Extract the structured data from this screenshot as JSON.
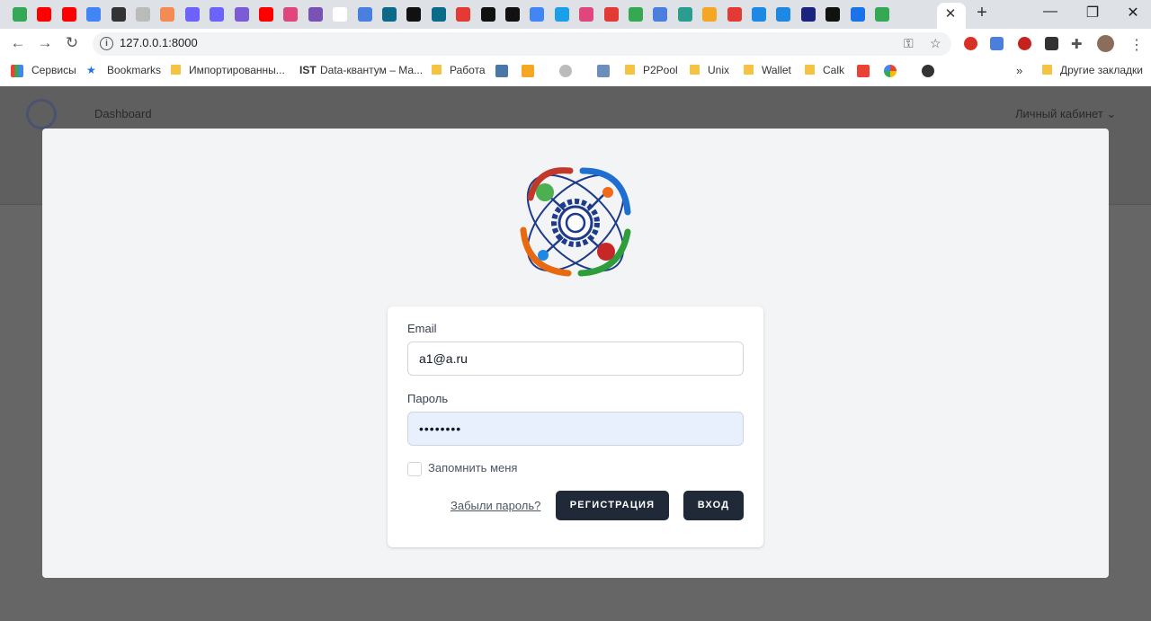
{
  "browser": {
    "url": "127.0.0.1:8000",
    "tab_close_glyph": "✕",
    "new_tab_glyph": "+",
    "window_controls": [
      "—",
      "❐",
      "✕"
    ],
    "bookmarks": [
      {
        "label": "Сервисы",
        "icon": "apps-grid-icon"
      },
      {
        "label": "Bookmarks",
        "icon": "star-icon"
      },
      {
        "label": "Импортированны...",
        "icon": "folder-icon"
      },
      {
        "label": "Data-квантум – Ма...",
        "icon": "ist-icon",
        "prefix": "IST"
      },
      {
        "label": "Работа",
        "icon": "folder-icon"
      },
      {
        "label": "P2Pool",
        "icon": "folder-icon"
      },
      {
        "label": "Unix",
        "icon": "folder-icon"
      },
      {
        "label": "Wallet",
        "icon": "folder-icon"
      },
      {
        "label": "Calk",
        "icon": "folder-icon"
      },
      {
        "label": "Другие закладки",
        "icon": "folder-icon"
      }
    ],
    "more_bookmarks_glyph": "»"
  },
  "app": {
    "nav_link": "Dashboard",
    "account_menu": "Личный кабинет ⌄"
  },
  "login": {
    "email_label": "Email",
    "email_value": "a1@a.ru",
    "password_label": "Пароль",
    "password_value": "••••••••",
    "remember_label": "Запомнить меня",
    "forgot_link": "Забыли пароль?",
    "register_button": "РЕГИСТРАЦИЯ",
    "login_button": "ВХОД"
  },
  "colors": {
    "primary_button": "#1f2937",
    "overlay": "#666666",
    "autofill": "#e8f0fe"
  }
}
